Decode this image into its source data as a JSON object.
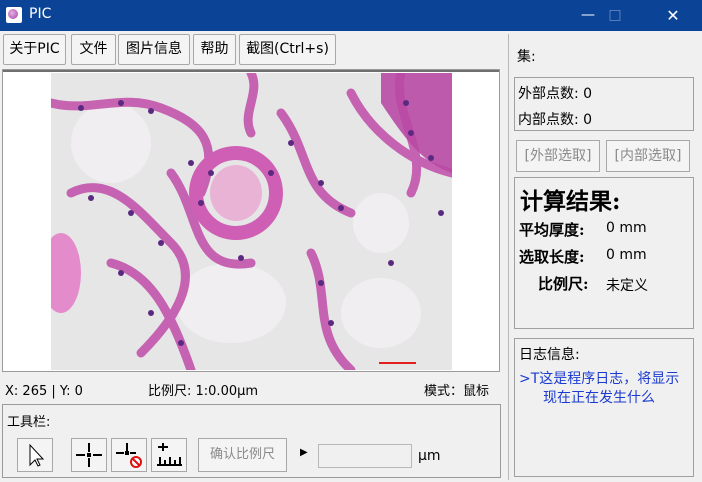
{
  "window": {
    "title": "PIC",
    "minimize": "—",
    "maximize": "□",
    "close": "✕"
  },
  "menu": [
    "关于PIC",
    "文件",
    "图片信息",
    "帮助",
    "截图(Ctrl+s)"
  ],
  "status": {
    "coords": "X: 265 | Y: 0",
    "scale": "比例尺: 1:0.00μm",
    "mode": "模式：鼠标"
  },
  "toolbar": {
    "label": "工具栏:",
    "confirm_label": "确认比例尺",
    "arrow": "▶",
    "scale_value": "",
    "unit": "μm"
  },
  "panel": {
    "set_label": "集:",
    "outer_points": "外部点数: 0",
    "inner_points": "内部点数: 0",
    "outer_select": "[外部选取]",
    "inner_select": "[内部选取]",
    "result_title": "计算结果:",
    "avg_thickness_label": "平均厚度:",
    "avg_thickness_value": "0 mm",
    "sel_length_label": "选取长度:",
    "sel_length_value": "0 mm",
    "scale_label": "比例尺:",
    "scale_value": "未定义",
    "log_title": "日志信息:",
    "log_line1": ">T这是程序日志，将显示",
    "log_line2": "现在正在发生什么"
  },
  "colors": {
    "titlebar": "#0b4496",
    "log_text": "#1a3ad0",
    "tissue": "#c04ca8",
    "nuclei": "#5a2a80"
  },
  "icons": [
    "pointer-icon",
    "crosshair-add-icon",
    "crosshair-remove-icon",
    "scale-ruler-icon"
  ]
}
